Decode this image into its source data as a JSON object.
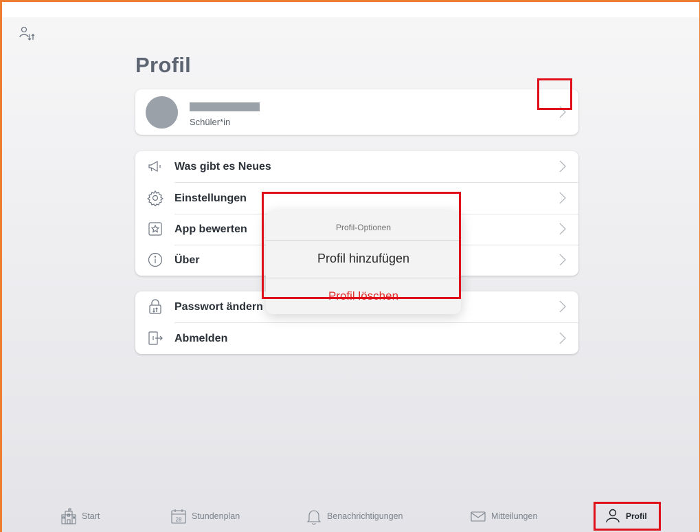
{
  "page": {
    "title": "Profil"
  },
  "profile": {
    "role": "Schüler*in"
  },
  "menu_main": [
    {
      "label": "Was gibt es Neues",
      "icon": "megaphone-icon"
    },
    {
      "label": "Einstellungen",
      "icon": "gear-icon"
    },
    {
      "label": "App bewerten",
      "icon": "star-icon"
    },
    {
      "label": "Über",
      "icon": "info-icon"
    }
  ],
  "menu_account": [
    {
      "label": "Passwort ändern",
      "icon": "lock-icon"
    },
    {
      "label": "Abmelden",
      "icon": "logout-icon"
    }
  ],
  "popover": {
    "title": "Profil-Optionen",
    "add_label": "Profil hinzufügen",
    "delete_label": "Profil löschen"
  },
  "tabs": [
    {
      "label": "Start",
      "icon": "school-icon"
    },
    {
      "label": "Stundenplan",
      "icon": "calendar-icon",
      "day": "28"
    },
    {
      "label": "Benachrichtigungen",
      "icon": "bell-icon"
    },
    {
      "label": "Mitteilungen",
      "icon": "envelope-icon"
    },
    {
      "label": "Profil",
      "icon": "person-icon",
      "active": true
    }
  ],
  "colors": {
    "highlight": "#e0101b",
    "delete": "#e12b2b",
    "frame": "#ec7d31",
    "title": "#5c6571"
  }
}
